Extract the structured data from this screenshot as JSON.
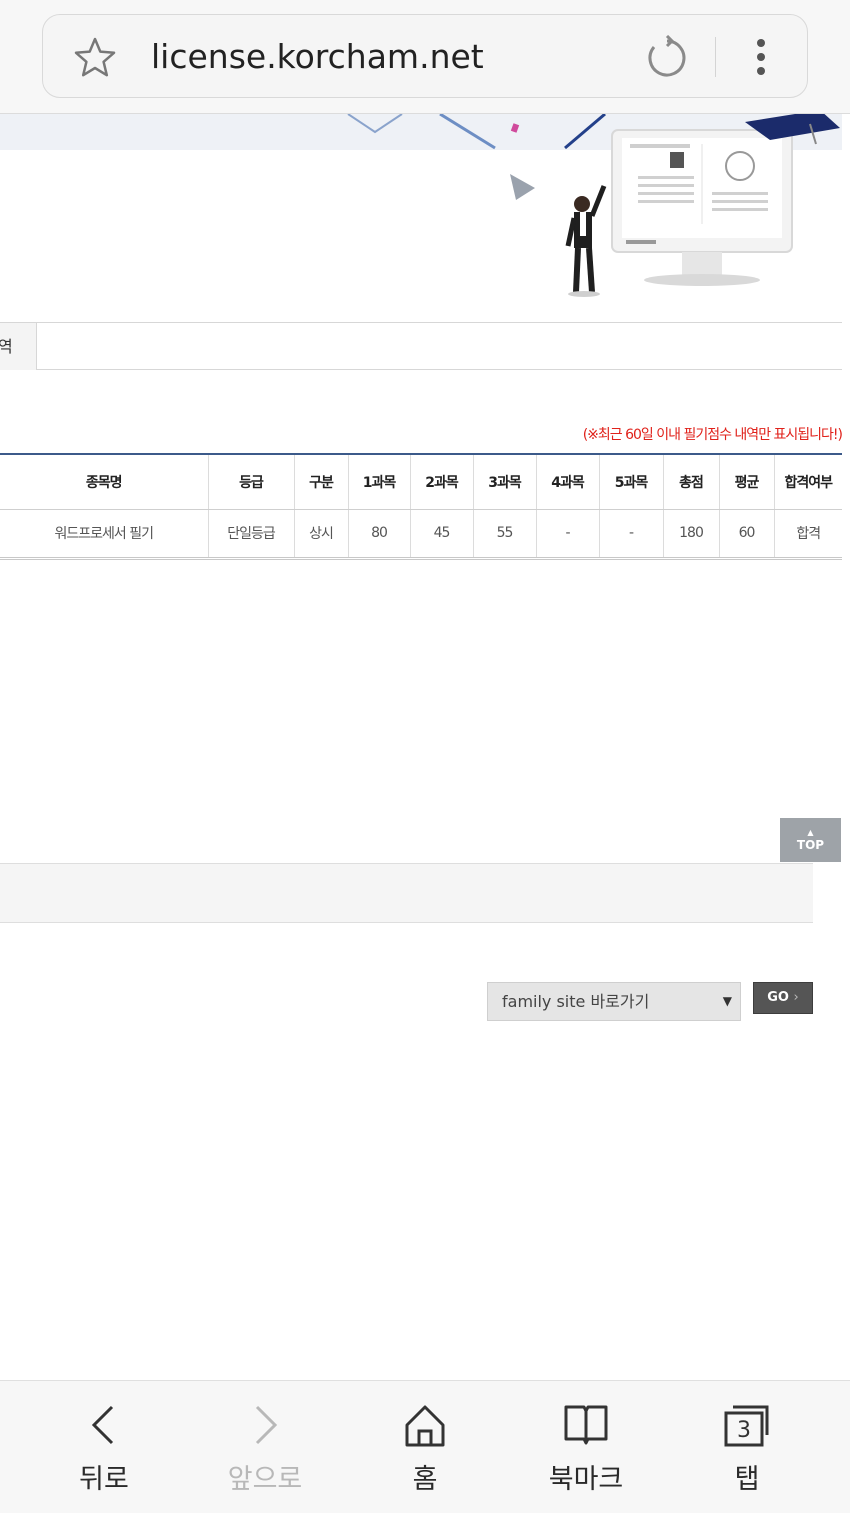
{
  "browser": {
    "url": "license.korcham.net"
  },
  "tabs": {
    "partial_label": "역"
  },
  "notice": "(※최근 60일 이내 필기점수 내역만 표시됩니다!)",
  "table": {
    "headers": [
      "종목명",
      "등급",
      "구분",
      "1과목",
      "2과목",
      "3과목",
      "4과목",
      "5과목",
      "총점",
      "평균",
      "합격여부"
    ],
    "rows": [
      [
        "워드프로세서 필기",
        "단일등급",
        "상시",
        "80",
        "45",
        "55",
        "-",
        "-",
        "180",
        "60",
        "합격"
      ]
    ]
  },
  "top_button": {
    "label": "TOP"
  },
  "family_site": {
    "selected": "family site 바로가기",
    "go_label": "GO"
  },
  "bottom_nav": {
    "back": "뒤로",
    "forward": "앞으로",
    "home": "홈",
    "bookmarks": "북마크",
    "tabs": "탭",
    "tab_count": "3"
  }
}
